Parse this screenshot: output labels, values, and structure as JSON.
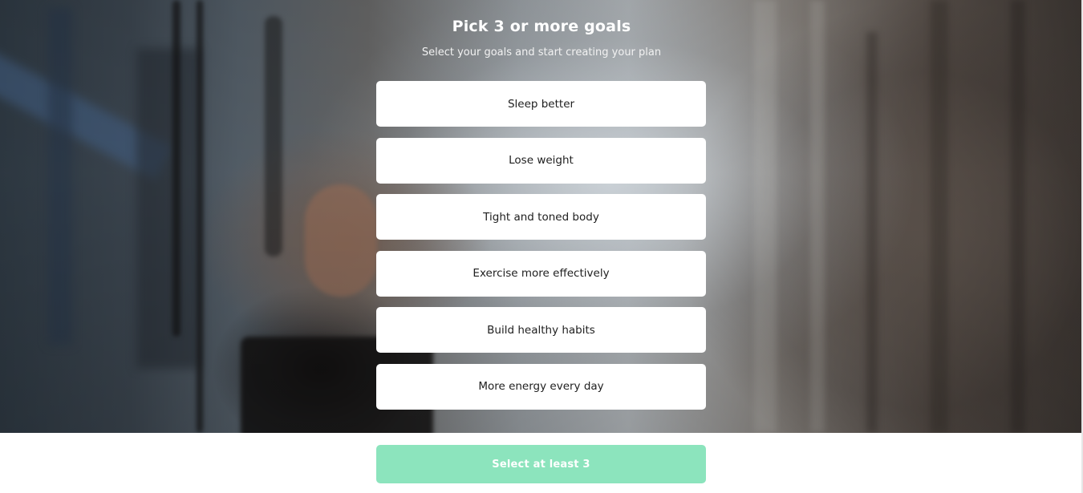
{
  "header": {
    "title": "Pick 3 or more goals",
    "subtitle": "Select your goals and start creating your plan"
  },
  "goals": [
    {
      "label": "Sleep better"
    },
    {
      "label": "Lose weight"
    },
    {
      "label": "Tight and toned body"
    },
    {
      "label": "Exercise more effectively"
    },
    {
      "label": "Build healthy habits"
    },
    {
      "label": "More energy every day"
    }
  ],
  "cta": {
    "label": "Select at least 3",
    "color": "#8ce4bd"
  },
  "background": {
    "icon": "gym-photo-background"
  }
}
